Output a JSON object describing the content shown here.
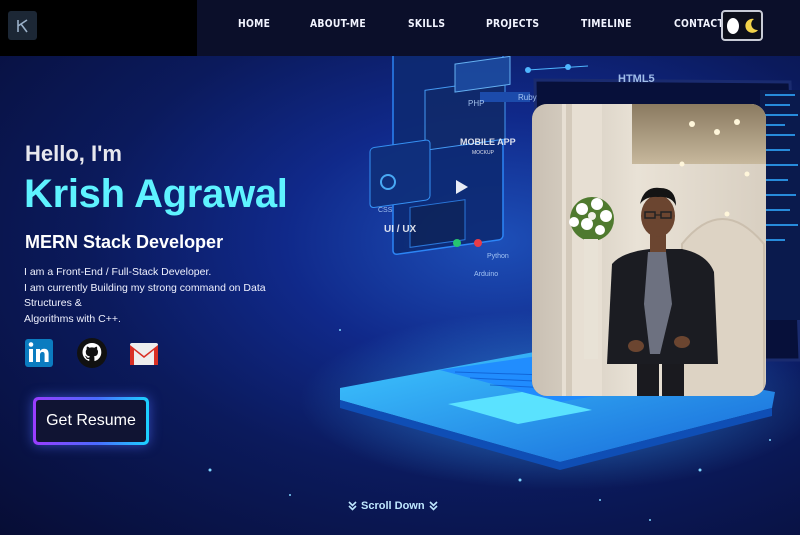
{
  "brand": {
    "logo_icon": "k-monogram-icon"
  },
  "nav": {
    "items": [
      {
        "label": "HOME"
      },
      {
        "label": "ABOUT-ME"
      },
      {
        "label": "SKILLS"
      },
      {
        "label": "PROJECTS"
      },
      {
        "label": "TIMELINE"
      },
      {
        "label": "CONTACT-ME"
      }
    ],
    "theme_toggle_icon": "moon-toggle-icon"
  },
  "hero": {
    "greeting": "Hello, I'm",
    "name": "Krish Agrawal",
    "role": "MERN Stack Developer",
    "bio_lines": [
      "I am a Front-End / Full-Stack Developer.",
      "I am currently Building my strong command on Data Structures &",
      "Algorithms with C++."
    ],
    "resume_button": "Get Resume",
    "scroll_label": "Scroll Down"
  },
  "illustration": {
    "labels": [
      "HTML5",
      "PHP",
      "Ruby",
      "MOBILE APP",
      "MOCKUP",
      "UI / UX",
      "CSS",
      "Python",
      "Arduino"
    ]
  },
  "socials": [
    {
      "name": "linkedin",
      "icon": "linkedin-icon"
    },
    {
      "name": "github",
      "icon": "github-icon"
    },
    {
      "name": "gmail",
      "icon": "gmail-icon"
    }
  ],
  "colors": {
    "accent_cyan": "#5ef3ff",
    "nav_bg": "#0b0f2a",
    "page_bg": "#0a1240"
  }
}
